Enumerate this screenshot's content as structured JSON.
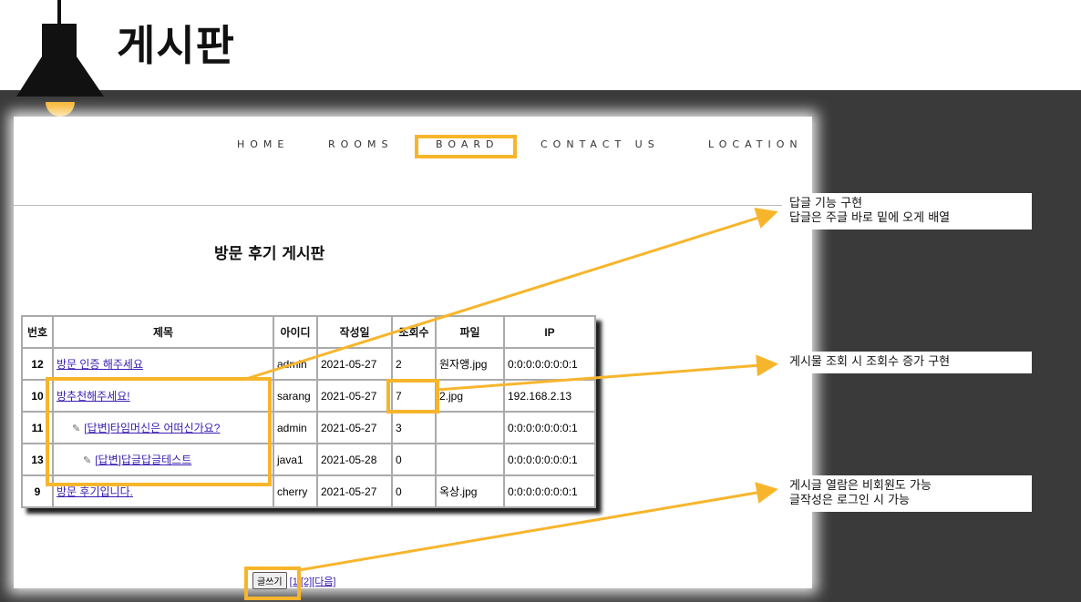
{
  "page_title": "게시판",
  "nav": {
    "items": [
      "HOME",
      "ROOMS",
      "BOARD",
      "CONTACT US",
      "LOCATION"
    ]
  },
  "board": {
    "heading": "방문 후기 게시판",
    "columns": [
      "번호",
      "제목",
      "아이디",
      "작성일",
      "조회수",
      "파일",
      "IP"
    ],
    "rows": [
      {
        "no": "12",
        "title": "방문 인증 해주세요",
        "id": "admin",
        "date": "2021-05-27",
        "views": "2",
        "file": "원자앵.jpg",
        "ip": "0:0:0:0:0:0:0:1",
        "reply": false
      },
      {
        "no": "10",
        "title": "방추천해주세요!",
        "id": "sarang",
        "date": "2021-05-27",
        "views": "7",
        "file": "2.jpg",
        "ip": "192.168.2.13",
        "reply": false
      },
      {
        "no": "11",
        "title": "[답변]타임머신은 어떠신가요?",
        "id": "admin",
        "date": "2021-05-27",
        "views": "3",
        "file": "",
        "ip": "0:0:0:0:0:0:0:1",
        "reply": true
      },
      {
        "no": "13",
        "title": "[답변]답글답글테스트",
        "id": "java1",
        "date": "2021-05-28",
        "views": "0",
        "file": "",
        "ip": "0:0:0:0:0:0:0:1",
        "reply": true
      },
      {
        "no": "9",
        "title": "방문 후기입니다.",
        "id": "cherry",
        "date": "2021-05-27",
        "views": "0",
        "file": "옥상.jpg",
        "ip": "0:0:0:0:0:0:0:1",
        "reply": false
      }
    ]
  },
  "footer": {
    "write_button": "글쓰기",
    "pages": "[1][2]",
    "next": "[다음]"
  },
  "callouts": {
    "reply_line1": "답글 기능 구현",
    "reply_line2": "답글은 주글 바로 밑에 오게 배열",
    "views": "게시물 조회 시 조회수 증가 구현",
    "auth_line1": "게시글 열람은 비회원도 가능",
    "auth_line2": "글작성은 로그인 시 가능"
  },
  "colors": {
    "highlight": "#f7b52c",
    "dark_background": "#3a3a3a",
    "link": "#3a1bb0"
  },
  "icons": [
    "lamp-icon",
    "memo-icon"
  ]
}
